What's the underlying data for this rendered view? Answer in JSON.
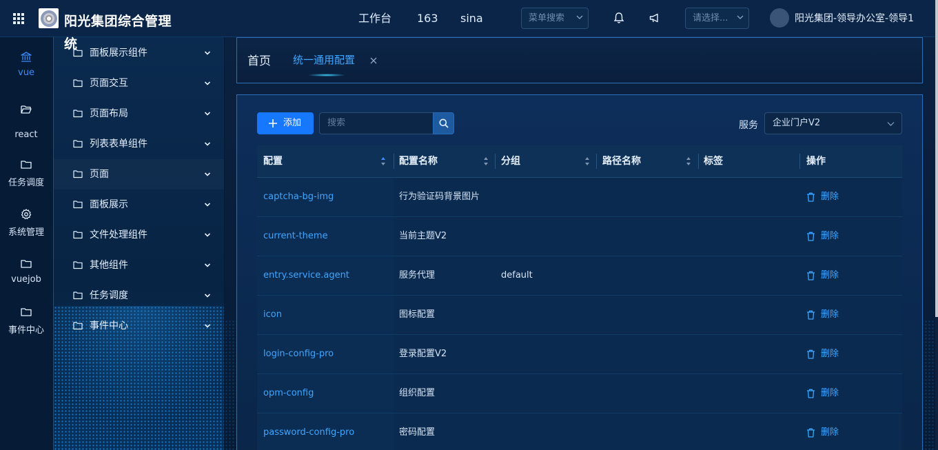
{
  "header": {
    "app_title": "阳光集团综合管理系",
    "app_title_tail": "统",
    "nav": [
      "工作台",
      "163",
      "sina"
    ],
    "menu_search_placeholder": "菜单搜索",
    "top_select_placeholder": "请选择...",
    "user_name": "阳光集团-领导办公室-领导1"
  },
  "rail": {
    "items": [
      {
        "label": "vue",
        "icon": "bank-icon",
        "active": true
      },
      {
        "label": "react",
        "icon": "folder-open-icon"
      },
      {
        "label": "任务调度",
        "icon": "folder-icon"
      },
      {
        "label": "系统管理",
        "icon": "gear-icon"
      },
      {
        "label": "vuejob",
        "icon": "folder-icon"
      },
      {
        "label": "事件中心",
        "icon": "folder-icon"
      }
    ]
  },
  "submenu": {
    "items": [
      {
        "label": "面板展示组件"
      },
      {
        "label": "页面交互"
      },
      {
        "label": "页面布局"
      },
      {
        "label": "列表表单组件"
      },
      {
        "label": "页面"
      },
      {
        "label": "面板展示"
      },
      {
        "label": "文件处理组件"
      },
      {
        "label": "其他组件"
      },
      {
        "label": "任务调度"
      },
      {
        "label": "事件中心"
      }
    ]
  },
  "tabs": {
    "home": "首页",
    "active": "统一通用配置"
  },
  "toolbar": {
    "add_label": "添加",
    "search_placeholder": "搜索",
    "service_label": "服务",
    "service_value": "企业门户V2"
  },
  "table": {
    "columns": [
      "配置",
      "配置名称",
      "分组",
      "路径名称",
      "标签",
      "操作"
    ],
    "rows": [
      {
        "key": "captcha-bg-img",
        "name": "行为验证码背景图片",
        "group": "",
        "action": "删除"
      },
      {
        "key": "current-theme",
        "name": "当前主题V2",
        "group": "",
        "action": "删除"
      },
      {
        "key": "entry.service.agent",
        "name": "服务代理",
        "group": "default",
        "action": "删除"
      },
      {
        "key": "icon",
        "name": "图标配置",
        "group": "",
        "action": "删除"
      },
      {
        "key": "login-config-pro",
        "name": "登录配置V2",
        "group": "",
        "action": "删除"
      },
      {
        "key": "opm-config",
        "name": "组织配置",
        "group": "",
        "action": "删除"
      },
      {
        "key": "password-config-pro",
        "name": "密码配置",
        "group": "",
        "action": "删除"
      }
    ]
  },
  "colors": {
    "accent": "#1677ff",
    "link": "#3fa6ff",
    "header_bg": "#0a2547"
  }
}
